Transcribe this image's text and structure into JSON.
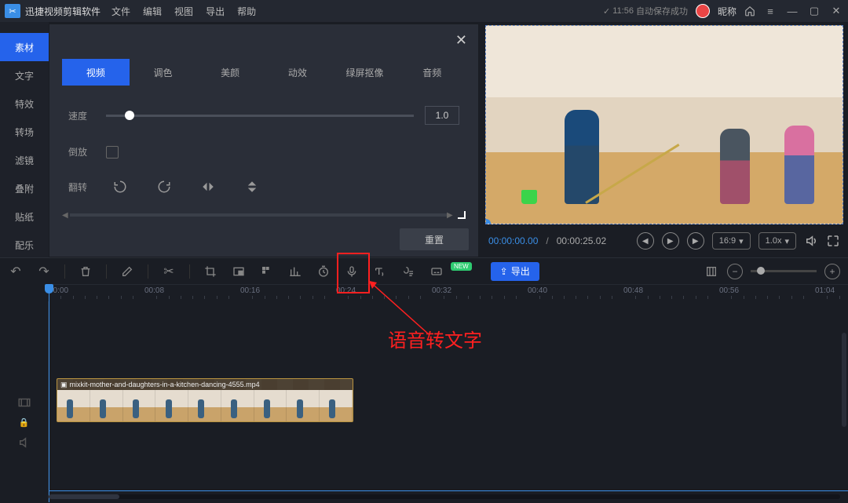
{
  "titlebar": {
    "app_name": "迅捷视频剪辑软件",
    "menus": [
      "文件",
      "编辑",
      "视图",
      "导出",
      "帮助"
    ],
    "save_time": "11:56",
    "save_status": "自动保存成功",
    "nickname": "昵称"
  },
  "sidebar": {
    "items": [
      "素材",
      "文字",
      "特效",
      "转场",
      "滤镜",
      "叠附",
      "贴纸",
      "配乐"
    ],
    "active_index": 0
  },
  "panel": {
    "tabs": [
      "视频",
      "调色",
      "美颜",
      "动效",
      "绿屏抠像",
      "音频"
    ],
    "active_tab": 0,
    "speed_label": "速度",
    "speed_value": "1.0",
    "reverse_label": "倒放",
    "reverse_checked": false,
    "flip_label": "翻转",
    "reset_label": "重置"
  },
  "preview": {
    "current_time": "00:00:00.00",
    "separator": "/",
    "duration": "00:00:25.02",
    "aspect_label": "16:9",
    "speed_label": "1.0x"
  },
  "toolbar": {
    "new_badge": "NEW",
    "export_label": "导出"
  },
  "ruler": {
    "ticks": [
      {
        "pos": 0,
        "label": "00:00"
      },
      {
        "pos": 122,
        "label": "00:08"
      },
      {
        "pos": 244,
        "label": "00:16"
      },
      {
        "pos": 366,
        "label": "00:24"
      },
      {
        "pos": 488,
        "label": "00:32"
      },
      {
        "pos": 610,
        "label": "00:40"
      },
      {
        "pos": 732,
        "label": "00:48"
      },
      {
        "pos": 854,
        "label": "00:56"
      },
      {
        "pos": 976,
        "label": "01:04"
      }
    ]
  },
  "timeline": {
    "clip_name": "mixkit-mother-and-daughters-in-a-kitchen-dancing-4555.mp4"
  },
  "annotation": {
    "label": "语音转文字"
  }
}
